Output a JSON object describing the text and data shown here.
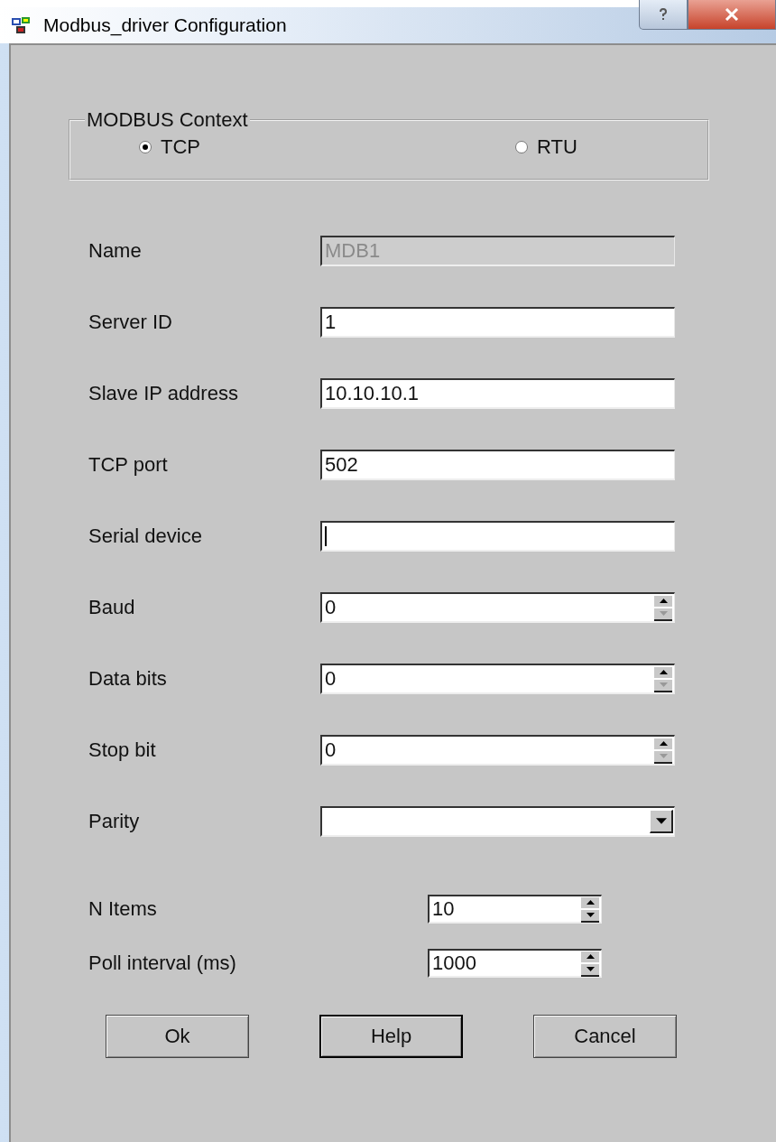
{
  "window": {
    "title": "Modbus_driver Configuration"
  },
  "context_group": {
    "label": "MODBUS Context",
    "options": [
      {
        "label": "TCP",
        "selected": true
      },
      {
        "label": "RTU",
        "selected": false
      }
    ]
  },
  "fields": [
    {
      "kind": "text",
      "label": "Name",
      "value": "MDB1",
      "disabled": true,
      "focused": false
    },
    {
      "kind": "text",
      "label": "Server ID",
      "value": "1",
      "disabled": false,
      "focused": false
    },
    {
      "kind": "text",
      "label": "Slave IP address",
      "value": "10.10.10.1",
      "disabled": false,
      "focused": false
    },
    {
      "kind": "text",
      "label": "TCP port",
      "value": "502",
      "disabled": false,
      "focused": false
    },
    {
      "kind": "text",
      "label": "Serial device",
      "disabled": false,
      "focused": true
    },
    {
      "kind": "spin",
      "label": "Baud",
      "value": "0",
      "disabled": false,
      "focused": false,
      "down_disabled": true
    },
    {
      "kind": "spin",
      "label": "Data bits",
      "value": "0",
      "disabled": false,
      "focused": false,
      "down_disabled": true
    },
    {
      "kind": "spin",
      "label": "Stop bit",
      "value": "0",
      "disabled": false,
      "focused": false,
      "down_disabled": true
    },
    {
      "kind": "combo",
      "label": "Parity",
      "disabled": false,
      "focused": false
    }
  ],
  "small_fields": [
    {
      "kind": "spin",
      "label": "N Items",
      "value": "10",
      "disabled": false,
      "focused": false,
      "down_disabled": false
    },
    {
      "kind": "spin",
      "label": "Poll interval (ms)",
      "value": "1000",
      "disabled": false,
      "focused": false,
      "down_disabled": false
    }
  ],
  "buttons": [
    {
      "label": "Ok",
      "default": false
    },
    {
      "label": "Help",
      "default": true
    },
    {
      "label": "Cancel",
      "default": false
    }
  ]
}
